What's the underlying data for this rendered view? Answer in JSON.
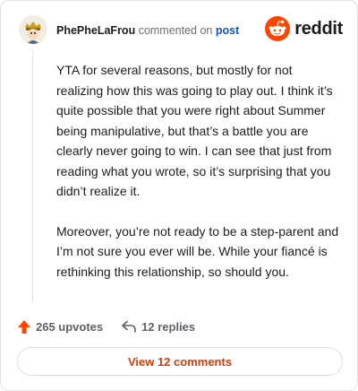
{
  "comment": {
    "username": "PhePheLaFrou",
    "action_text": " commented on ",
    "link_text": "post",
    "paragraphs": [
      "YTA for several reasons, but mostly for not realizing how this was going to play out. I think it’s quite possible that you were right about Summer being manipulative, but that’s a battle you are clearly never going to win. I can see that just from reading what you wrote, so it’s surprising that you didn’t realize it.",
      "Moreover, you’re not ready to be a step-parent and I’m not sure you ever will be. While your fiancé is rethinking this relationship, so should you."
    ]
  },
  "brand": {
    "name": "reddit",
    "color": "#ff4500",
    "icon": "reddit-snoo-icon"
  },
  "actions": {
    "upvotes_label": "265 upvotes",
    "replies_label": "12 replies",
    "upvote_icon": "upvote-arrow-icon",
    "reply_icon": "reply-arrow-icon",
    "upvote_color": "#ff4500"
  },
  "footer": {
    "view_comments_label": "View 12 comments"
  }
}
